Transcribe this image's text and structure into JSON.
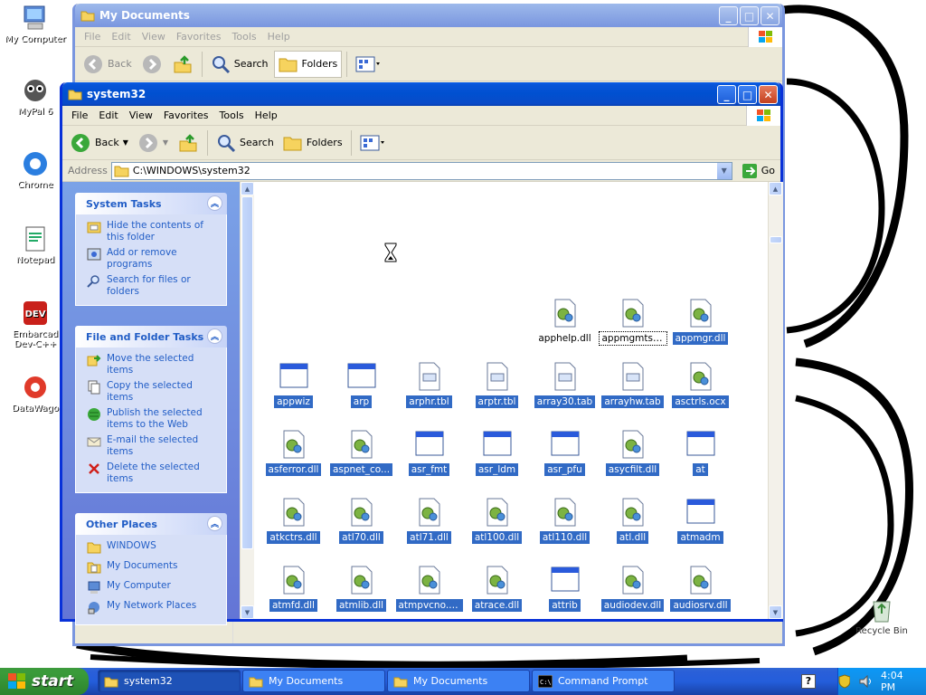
{
  "desktop": {
    "icons": [
      {
        "label": "My Computer"
      },
      {
        "label": "MyPal 6"
      },
      {
        "label": "Chrome"
      },
      {
        "label": "Notepad"
      },
      {
        "label": "Embarcad Dev-C++"
      },
      {
        "label": "DataWago"
      },
      {
        "label": "Recycle Bin"
      }
    ]
  },
  "back_window": {
    "title": "My Documents",
    "menu": [
      "File",
      "Edit",
      "View",
      "Favorites",
      "Tools",
      "Help"
    ],
    "toolbar": {
      "back": "Back",
      "search": "Search",
      "folders": "Folders"
    }
  },
  "front_window": {
    "title": "system32",
    "menu": [
      "File",
      "Edit",
      "View",
      "Favorites",
      "Tools",
      "Help"
    ],
    "toolbar": {
      "back": "Back",
      "search": "Search",
      "folders": "Folders"
    },
    "address": {
      "label": "Address",
      "value": "C:\\WINDOWS\\system32",
      "go": "Go"
    }
  },
  "task_pane": {
    "system_tasks": {
      "title": "System Tasks",
      "items": [
        "Hide the contents of this folder",
        "Add or remove programs",
        "Search for files or folders"
      ]
    },
    "file_folder_tasks": {
      "title": "File and Folder Tasks",
      "items": [
        "Move the selected items",
        "Copy the selected items",
        "Publish the selected items to the Web",
        "E-mail the selected items",
        "Delete the selected items"
      ]
    },
    "other_places": {
      "title": "Other Places",
      "items": [
        "WINDOWS",
        "My Documents",
        "My Computer",
        "My Network Places"
      ]
    }
  },
  "files": [
    {
      "name": "apphelp.dll"
    },
    {
      "name": "appmgmts.dll"
    },
    {
      "name": "appmgr.dll"
    },
    {
      "name": "appwiz"
    },
    {
      "name": "arp"
    },
    {
      "name": "arphr.tbl"
    },
    {
      "name": "arptr.tbl"
    },
    {
      "name": "array30.tab"
    },
    {
      "name": "arrayhw.tab"
    },
    {
      "name": "asctrls.ocx"
    },
    {
      "name": "asferror.dll"
    },
    {
      "name": "aspnet_co..."
    },
    {
      "name": "asr_fmt"
    },
    {
      "name": "asr_ldm"
    },
    {
      "name": "asr_pfu"
    },
    {
      "name": "asycfilt.dll"
    },
    {
      "name": "at"
    },
    {
      "name": "atkctrs.dll"
    },
    {
      "name": "atl70.dll"
    },
    {
      "name": "atl71.dll"
    },
    {
      "name": "atl100.dll"
    },
    {
      "name": "atl110.dll"
    },
    {
      "name": "atl.dll"
    },
    {
      "name": "atmadm"
    },
    {
      "name": "atmfd.dll"
    },
    {
      "name": "atmlib.dll"
    },
    {
      "name": "atmpvcno.dll"
    },
    {
      "name": "atrace.dll"
    },
    {
      "name": "attrib"
    },
    {
      "name": "audiodev.dll"
    },
    {
      "name": "audiosrv.dll"
    }
  ],
  "taskbar": {
    "start": "start",
    "items": [
      {
        "label": "system32"
      },
      {
        "label": "My Documents"
      },
      {
        "label": "My Documents"
      },
      {
        "label": "Command Prompt"
      }
    ],
    "clock": "4:04 PM"
  }
}
